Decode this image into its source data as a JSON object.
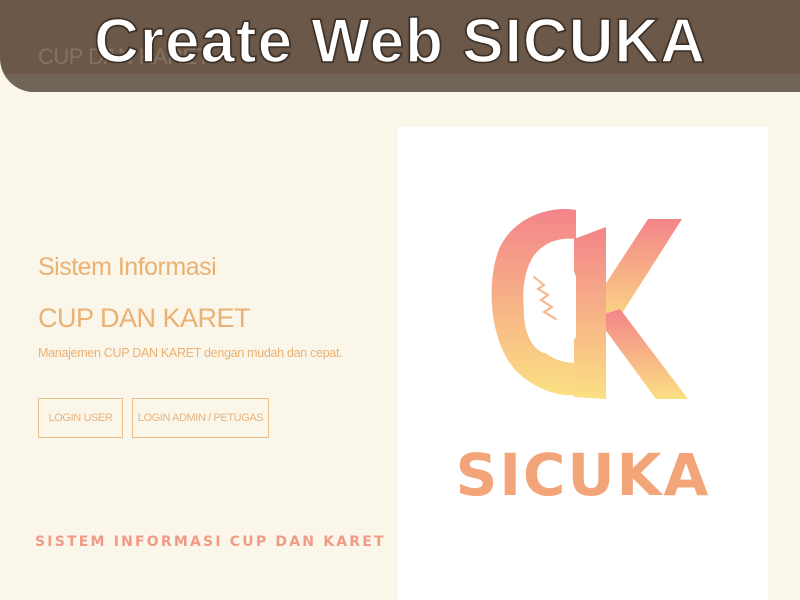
{
  "banner": {
    "title": "Create Web SICUKA",
    "background_brand": "CUP DAN KARET"
  },
  "hero": {
    "subtitle": "Sistem Informasi",
    "title": "CUP DAN KARET",
    "description": "Manajemen CUP DAN KARET dengan mudah dan cepat."
  },
  "buttons": {
    "login_user": "LOGIN USER",
    "login_admin": "LOGIN ADMIN / PETUGAS"
  },
  "logo": {
    "name": "SICUKA",
    "tagline": "SISTEM INFORMASI CUP DAN KARET",
    "gradient_top": "#f3848a",
    "gradient_bottom": "#fbe083",
    "icon": "ck-monogram-with-leaf"
  },
  "colors": {
    "page_background": "#faf6ea",
    "banner": "#6b5848",
    "accent_text": "#ebb173",
    "button_border": "#ebbd8a"
  }
}
